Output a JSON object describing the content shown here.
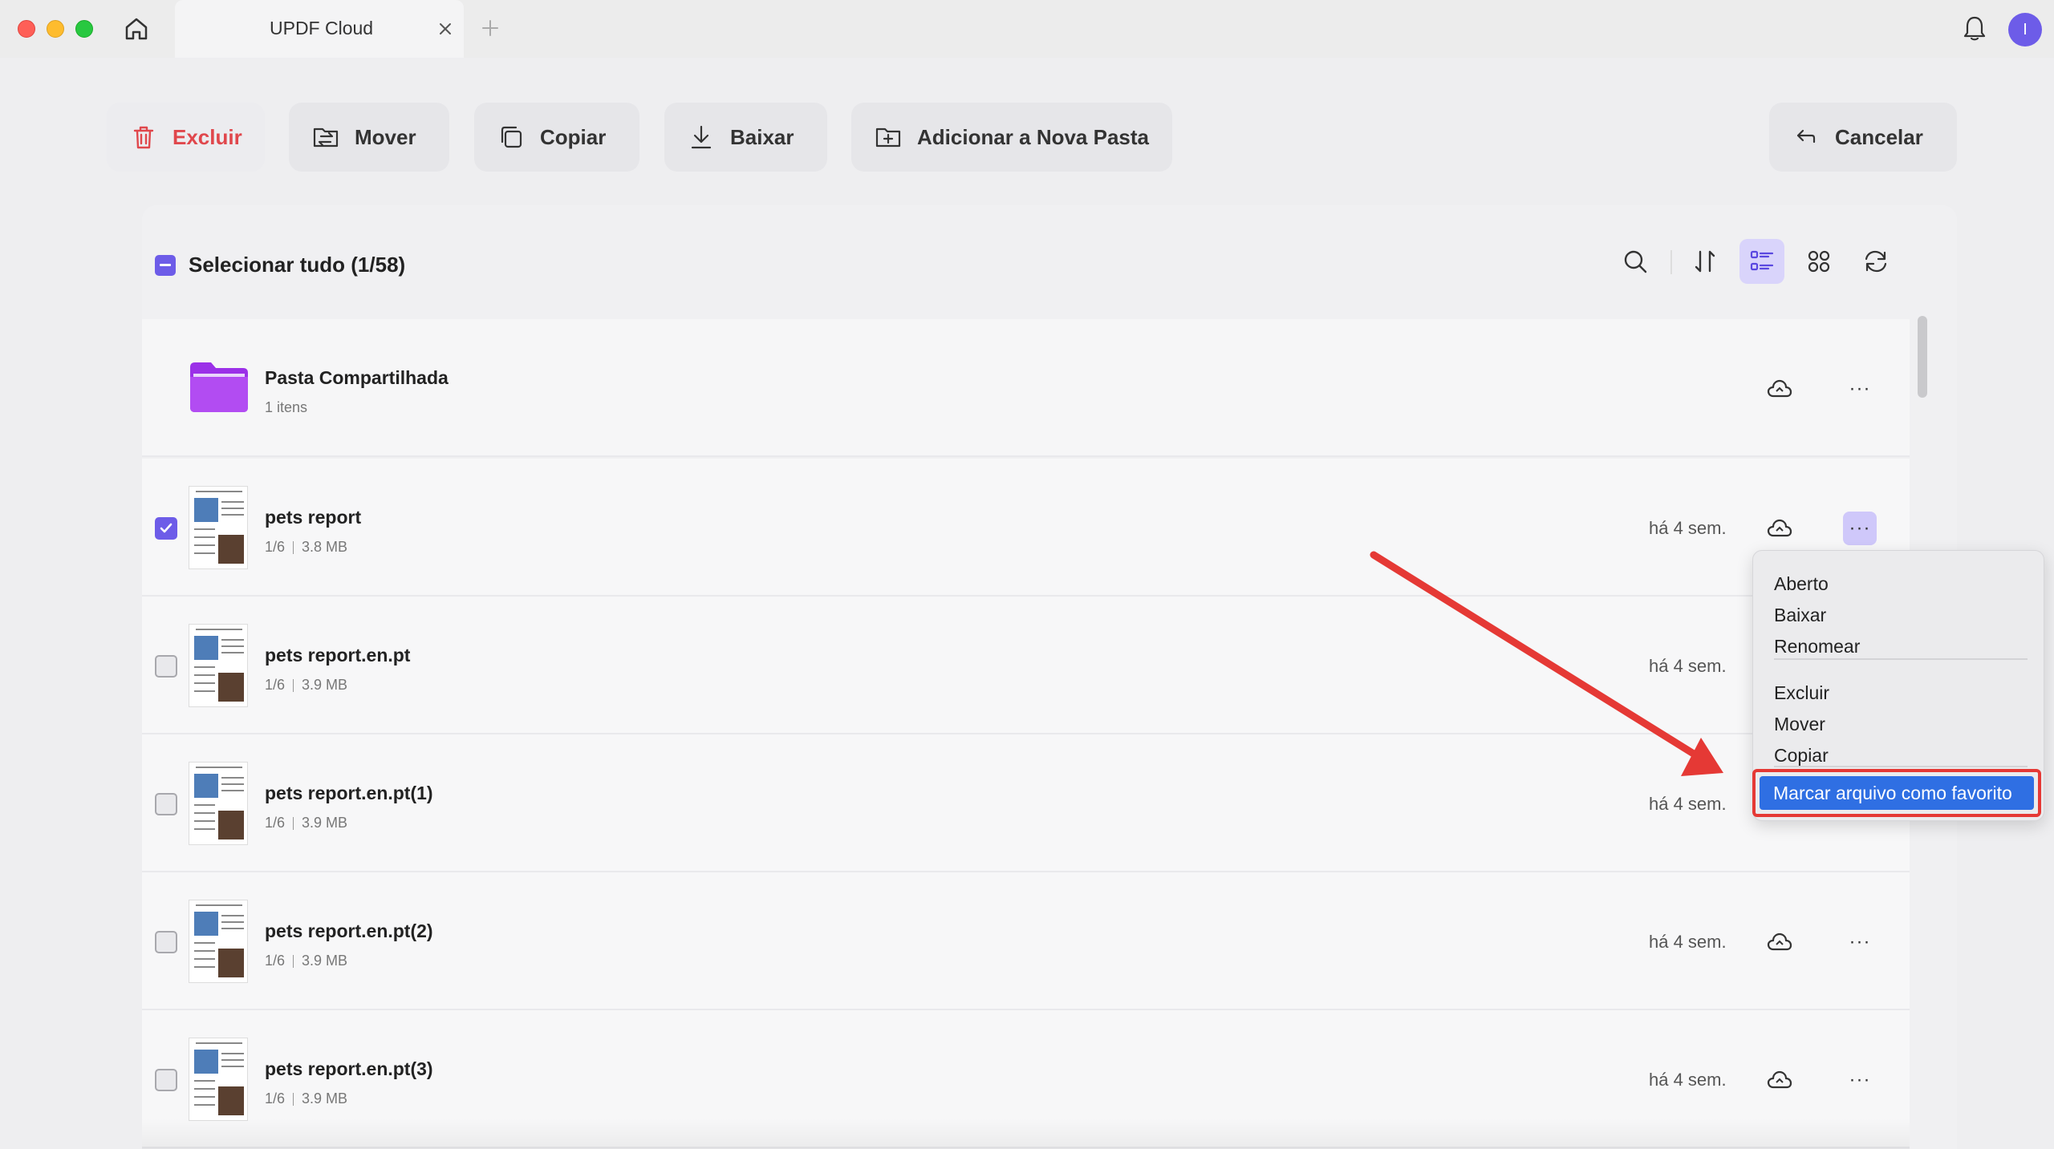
{
  "window": {
    "tab_title": "UPDF Cloud",
    "avatar_initial": "I"
  },
  "toolbar": {
    "delete_label": "Excluir",
    "move_label": "Mover",
    "copy_label": "Copiar",
    "download_label": "Baixar",
    "new_folder_label": "Adicionar a Nova Pasta",
    "cancel_label": "Cancelar"
  },
  "selection": {
    "select_all_label": "Selecionar tudo (1/58)"
  },
  "files": [
    {
      "name": "Pasta Compartilhada",
      "meta": "1 itens",
      "type": "folder"
    },
    {
      "name": "pets report",
      "pages": "1/6",
      "size": "3.8 MB",
      "date": "há 4 sem.",
      "checked": true
    },
    {
      "name": "pets report.en.pt",
      "pages": "1/6",
      "size": "3.9 MB",
      "date": "há 4 sem.",
      "checked": false
    },
    {
      "name": "pets report.en.pt(1)",
      "pages": "1/6",
      "size": "3.9 MB",
      "date": "há 4 sem.",
      "checked": false
    },
    {
      "name": "pets report.en.pt(2)",
      "pages": "1/6",
      "size": "3.9 MB",
      "date": "há 4 sem.",
      "checked": false
    },
    {
      "name": "pets report.en.pt(3)",
      "pages": "1/6",
      "size": "3.9 MB",
      "date": "há 4 sem.",
      "checked": false
    }
  ],
  "context_menu": {
    "open": "Aberto",
    "download": "Baixar",
    "rename": "Renomear",
    "delete": "Excluir",
    "move": "Mover",
    "copy": "Copiar",
    "favorite": "Marcar arquivo como favorito"
  },
  "colors": {
    "accent": "#6d5ce8",
    "danger": "#e0474c",
    "highlight_border": "#e53935",
    "menu_selected": "#2f6fe3"
  }
}
